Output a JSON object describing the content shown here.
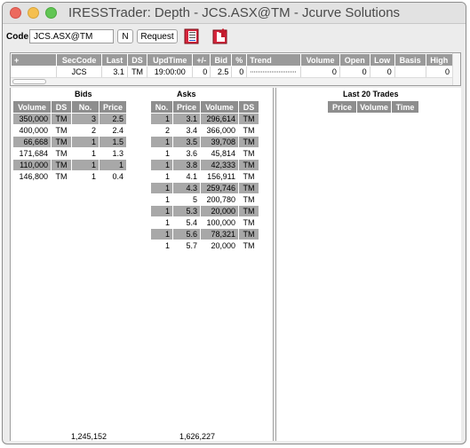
{
  "window": {
    "title": "IRESSTrader: Depth - JCS.ASX@TM - Jcurve Solutions"
  },
  "toolbar": {
    "code_label": "Code:",
    "code_value": "JCS.ASX@TM",
    "n_label": "N",
    "request_label": "Request",
    "icons": [
      "book-depth-icon",
      "book-refresh-icon"
    ]
  },
  "quote": {
    "headers": [
      "+",
      "SecCode",
      "Last",
      "DS",
      "UpdTime",
      "+/-",
      "Bid",
      "%",
      "Trend",
      "Volume",
      "Open",
      "Low",
      "Basis",
      "High"
    ],
    "row": [
      "",
      "JCS",
      "3.1",
      "TM",
      "19:00:00",
      "0",
      "2.5",
      "0",
      "",
      "0",
      "0",
      "0",
      "",
      "0"
    ]
  },
  "bids": {
    "title": "Bids",
    "headers": [
      "Volume",
      "DS",
      "No.",
      "Price"
    ],
    "rows": [
      [
        "350,000",
        "TM",
        "3",
        "2.5"
      ],
      [
        "400,000",
        "TM",
        "2",
        "2.4"
      ],
      [
        "66,668",
        "TM",
        "1",
        "1.5"
      ],
      [
        "171,684",
        "TM",
        "1",
        "1.3"
      ],
      [
        "110,000",
        "TM",
        "1",
        "1"
      ],
      [
        "146,800",
        "TM",
        "1",
        "0.4"
      ]
    ],
    "total": "1,245,152"
  },
  "asks": {
    "title": "Asks",
    "headers": [
      "No.",
      "Price",
      "Volume",
      "DS"
    ],
    "rows": [
      [
        "1",
        "3.1",
        "296,614",
        "TM"
      ],
      [
        "2",
        "3.4",
        "366,000",
        "TM"
      ],
      [
        "1",
        "3.5",
        "39,708",
        "TM"
      ],
      [
        "1",
        "3.6",
        "45,814",
        "TM"
      ],
      [
        "1",
        "3.8",
        "42,333",
        "TM"
      ],
      [
        "1",
        "4.1",
        "156,911",
        "TM"
      ],
      [
        "1",
        "4.3",
        "259,746",
        "TM"
      ],
      [
        "1",
        "5",
        "200,780",
        "TM"
      ],
      [
        "1",
        "5.3",
        "20,000",
        "TM"
      ],
      [
        "1",
        "5.4",
        "100,000",
        "TM"
      ],
      [
        "1",
        "5.6",
        "78,321",
        "TM"
      ],
      [
        "1",
        "5.7",
        "20,000",
        "TM"
      ]
    ],
    "total": "1,626,227"
  },
  "trades": {
    "title": "Last 20 Trades",
    "headers": [
      "Price",
      "Volume",
      "Time"
    ]
  },
  "colors": {
    "header_bg": "#8e8e8e",
    "shaded_row": "#a8a8a8",
    "close": "#ec6a5e",
    "minimize": "#f5bf4f",
    "maximize": "#61c554"
  }
}
